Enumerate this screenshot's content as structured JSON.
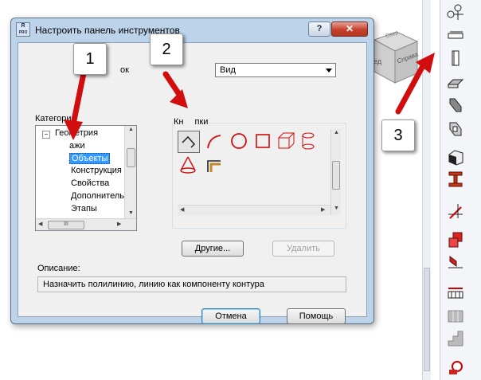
{
  "dialog": {
    "title": "Настроить панель инструментов",
    "icon_text_top": "R",
    "icon_text_bottom": "PRO",
    "help_label": "?",
    "close_label": "✕",
    "partial_label_left": "ок",
    "view_combo_value": "Вид",
    "categories_label": "Категори",
    "buttons_group_label": "Кн",
    "buttons_group_label_tail": "пки",
    "tree": [
      {
        "label": "Геометрия",
        "expander": "⊟",
        "selected": false
      },
      {
        "label": "ажи",
        "selected": false
      },
      {
        "label": "Объекты",
        "selected": true
      },
      {
        "label": "Конструкция",
        "selected": false
      },
      {
        "label": "Свойства",
        "selected": false
      },
      {
        "label": "Дополнитель",
        "selected": false
      },
      {
        "label": "Этапы",
        "selected": false
      }
    ],
    "other_button": "Другие...",
    "delete_button": "Удалить",
    "description_label": "Описание:",
    "description_value": "Назначить полилинию, линию как компоненту контура",
    "cancel_button": "Отмена",
    "help_button": "Помощь"
  },
  "viewcube": {
    "label_left": "ред",
    "label_right": "Справа",
    "label_top": "Свер"
  },
  "callouts": [
    {
      "number": "1"
    },
    {
      "number": "2"
    },
    {
      "number": "3"
    }
  ],
  "toolbar_icons": [
    "axis-marker-icon",
    "wall-icon",
    "column-icon",
    "slab-icon",
    "beam-icon",
    "opening-icon",
    "block-icon",
    "steel-beam-icon",
    "section-cut-icon",
    "stack-icon",
    "foundation-icon",
    "ruler-icon",
    "grid-icon",
    "stair-icon",
    "object-icon"
  ],
  "colors": {
    "accent_red": "#d10d0d",
    "selection": "#3399ff",
    "dialog_frame": "#bcd3ea"
  }
}
